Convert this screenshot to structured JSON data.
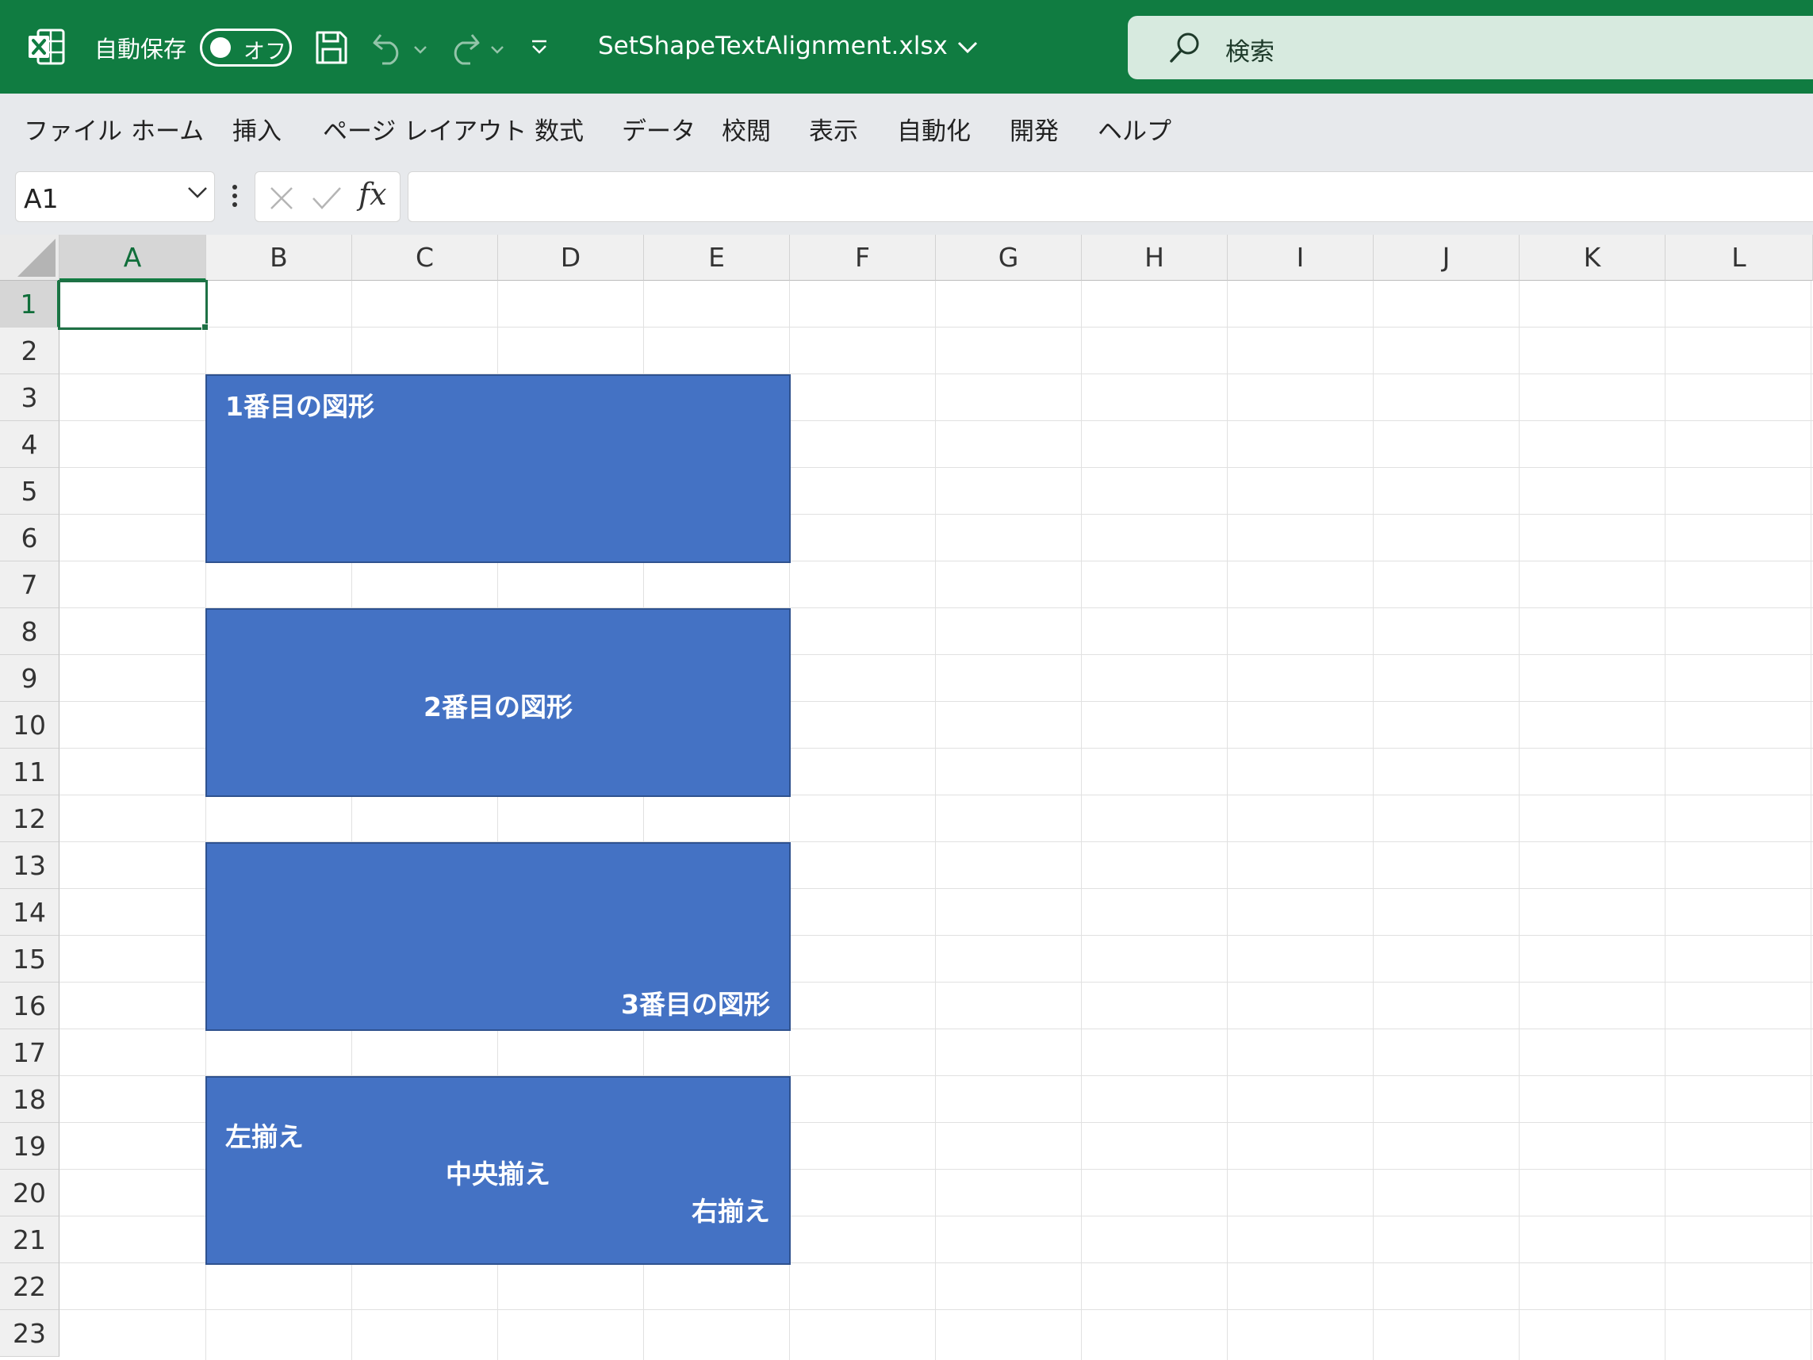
{
  "colors": {
    "brand": "#107c41",
    "search_bg": "#d7eadf",
    "ribbon_bg": "#e7e9ec",
    "shape_fill": "#4472c4",
    "shape_border": "#2f528f"
  },
  "titlebar": {
    "app_icon": "excel-icon",
    "autosave_label": "自動保存",
    "autosave_state": "オフ",
    "filename": "SetShapeTextAlignment.xlsx",
    "search_placeholder": "検索"
  },
  "menu": [
    "ファイル",
    "ホーム",
    "挿入",
    "ページ レイアウト",
    "数式",
    "データ",
    "校閲",
    "表示",
    "自動化",
    "開発",
    "ヘルプ"
  ],
  "formula_bar": {
    "name_box": "A1",
    "fx_label": "fx",
    "formula": ""
  },
  "grid": {
    "columns": [
      "A",
      "B",
      "C",
      "D",
      "E",
      "F",
      "G",
      "H",
      "I",
      "J",
      "K",
      "L"
    ],
    "rows": [
      "1",
      "2",
      "3",
      "4",
      "5",
      "6",
      "7",
      "8",
      "9",
      "10",
      "11",
      "12",
      "13",
      "14",
      "15",
      "16",
      "17",
      "18",
      "19",
      "20",
      "21",
      "22",
      "23"
    ],
    "selected_cell": "A1"
  },
  "shapes": {
    "shape1": "1番目の図形",
    "shape2": "2番目の図形",
    "shape3": "3番目の図形",
    "shape4": {
      "left": "左揃え",
      "center": "中央揃え",
      "right": "右揃え"
    }
  }
}
